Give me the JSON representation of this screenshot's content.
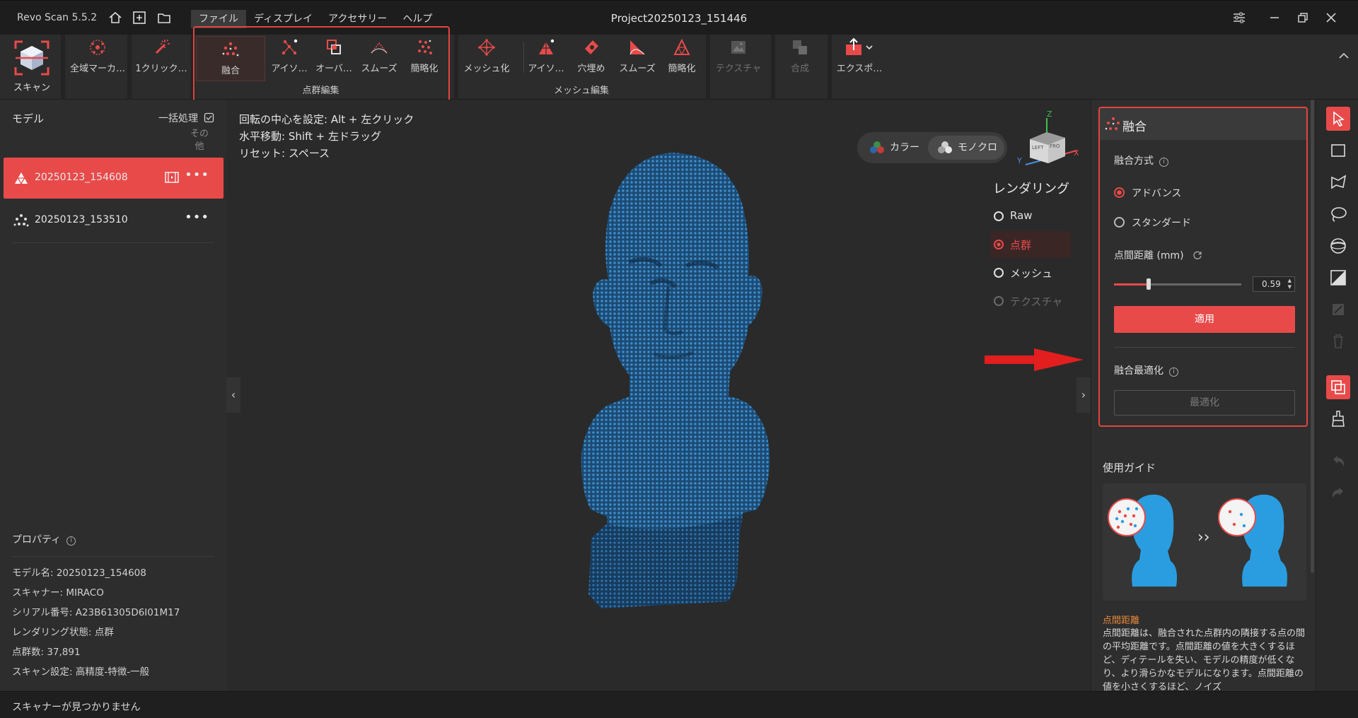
{
  "app": {
    "name": "Revo Scan 5.5.2",
    "project_title": "Project20250123_151446"
  },
  "menu": [
    "ファイル",
    "ディスプレイ",
    "アクセサリー",
    "ヘルプ"
  ],
  "ribbon": {
    "scan": "スキャン",
    "global_marker": "全域マーカ…",
    "one_click": "1クリック…",
    "pc_tools": [
      "融合",
      "アイソ…",
      "オーバ…",
      "スムーズ",
      "簡略化"
    ],
    "pc_group_label": "点群編集",
    "mesh_tools": [
      "メッシュ化",
      "アイソ…",
      "穴埋め",
      "スムーズ",
      "簡略化"
    ],
    "mesh_group_label": "メッシュ編集",
    "texture": "テクスチャ",
    "merge": "合成",
    "export": "エクスポ…"
  },
  "left": {
    "title": "モデル",
    "batch": "一括処理",
    "other": "その他",
    "models": [
      {
        "name": "20250123_154608"
      },
      {
        "name": "20250123_153510"
      }
    ],
    "properties_title": "プロパティ",
    "properties": [
      "モデル名:  20250123_154608",
      "スキャナー:  MIRACO",
      "シリアル番号:  A23B61305D6I01M17",
      "レンダリング状態:  点群",
      "点群数:  37,891",
      "スキャン設定:  高精度-特徴-一般"
    ]
  },
  "viewport": {
    "hints": [
      "回転の中心を設定: Alt + 左クリック",
      "水平移動: Shift + 左ドラッグ",
      "リセット: スペース"
    ],
    "color_mode": "カラー",
    "mono_mode": "モノクロ",
    "axes": {
      "x": "X",
      "y": "Y",
      "z": "Z",
      "left": "LEFT",
      "front": "FRO"
    },
    "rendering_title": "レンダリング",
    "rendering_options": [
      "Raw",
      "点群",
      "メッシュ",
      "テクスチャ"
    ]
  },
  "fusion": {
    "title": "融合",
    "method_label": "融合方式",
    "method_options": [
      "アドバンス",
      "スタンダード"
    ],
    "distance_label": "点間距離 (mm)",
    "distance_value": "0.59",
    "slider_fraction": 0.27,
    "apply": "適用",
    "optimize_label": "融合最適化",
    "optimize_button": "最適化"
  },
  "guide": {
    "title": "使用ガイド",
    "arrow": "››",
    "subtitle": "点間距離",
    "text": "点間距離は、融合された点群内の隣接する点の間の平均距離です。点間距離の値を大きくするほど、ディテールを失い、モデルの精度が低くなり、より滑らかなモデルになります。点間距離の値を小さくするほど、ノイズ"
  },
  "status": "スキャナーが見つかりません",
  "colors": {
    "accent": "#e84a4a",
    "annotation": "#e2453f",
    "point_cloud": "#2a6fa8"
  }
}
